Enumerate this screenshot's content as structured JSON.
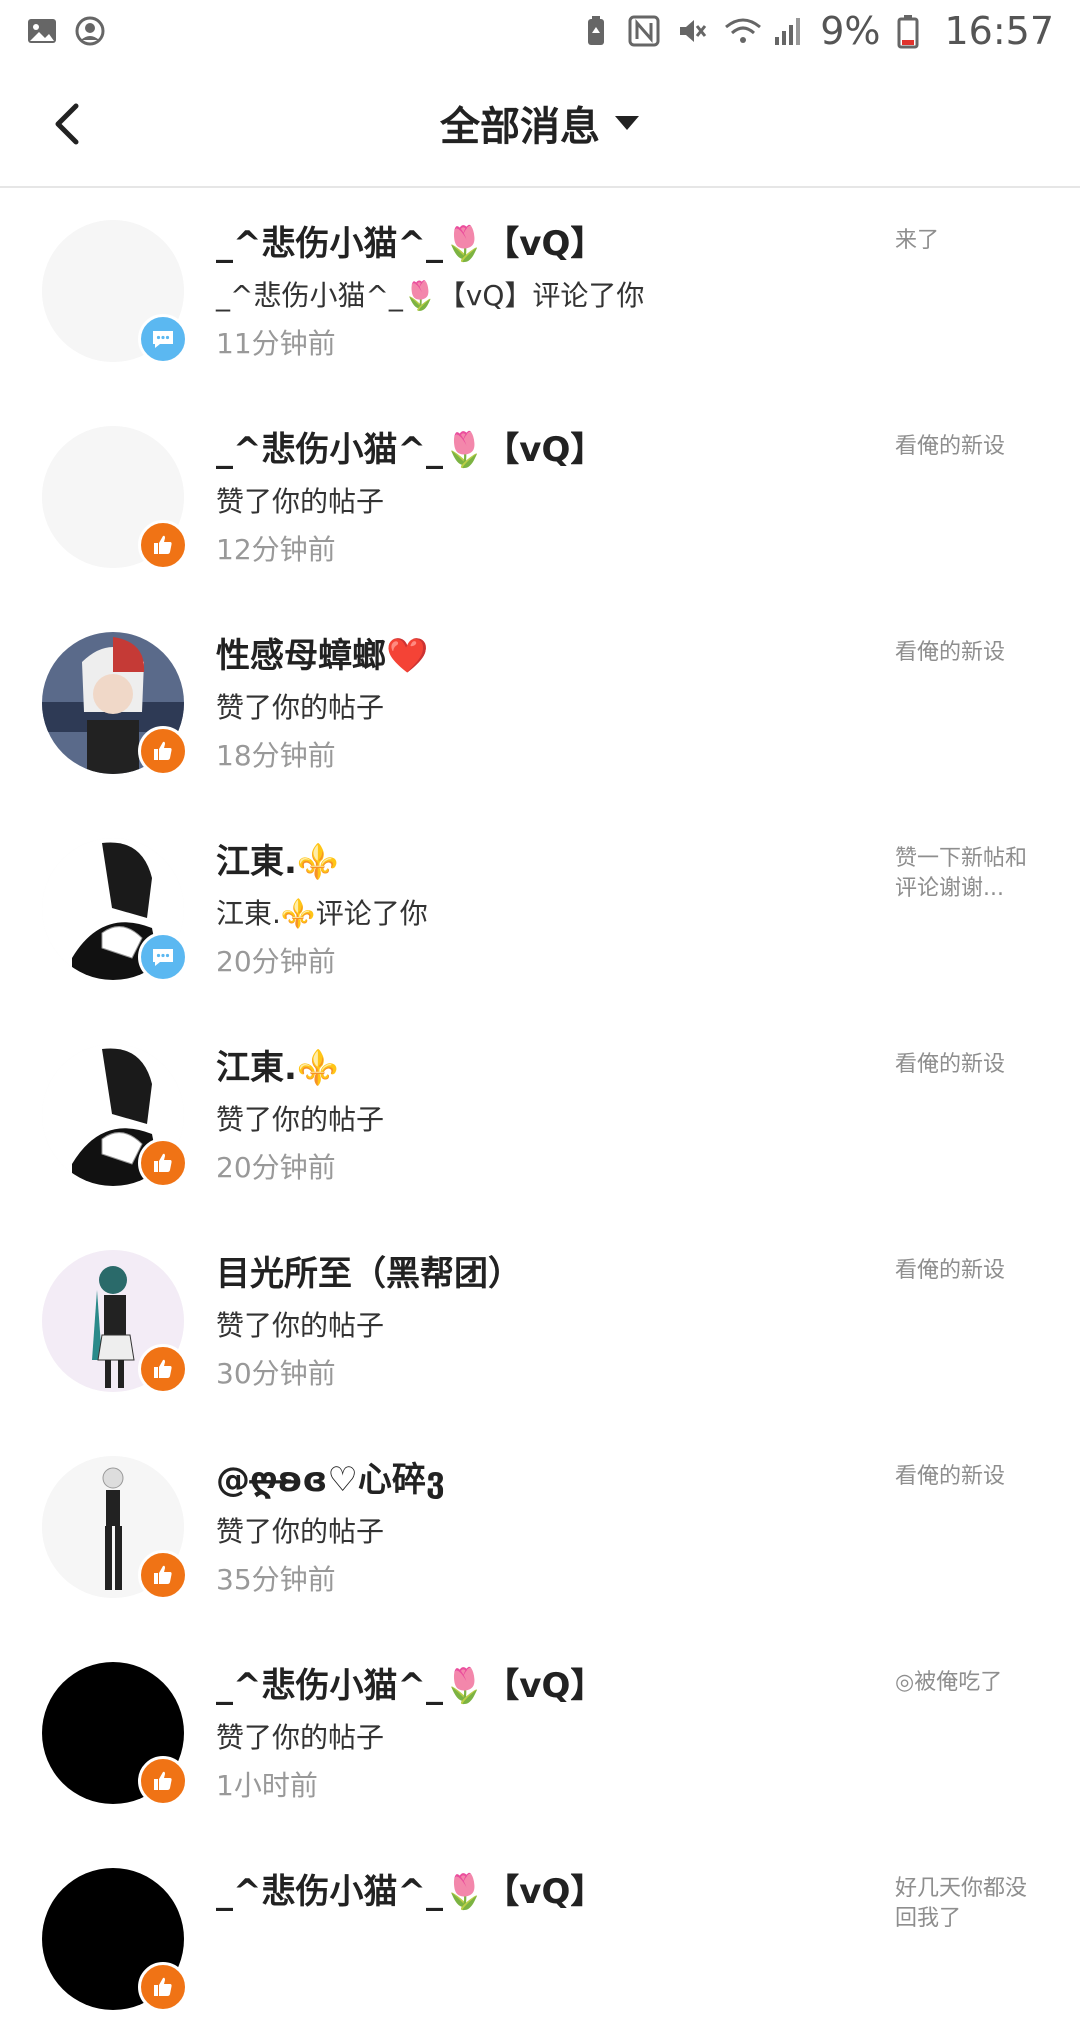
{
  "status_bar": {
    "battery": "9%",
    "time": "16:57",
    "icons": [
      "image-icon",
      "account-icon",
      "battery-saver-icon",
      "nfc-icon",
      "mute-icon",
      "wifi-icon",
      "signal-icon",
      "battery-icon"
    ]
  },
  "header": {
    "title": "全部消息",
    "back_icon": "back-arrow-icon",
    "dropdown_icon": "dropdown-triangle-icon"
  },
  "colors": {
    "like_badge": "#f07315",
    "comment_badge": "#5bb8f1",
    "text_primary": "#222222",
    "text_secondary": "#999999"
  },
  "notifications": [
    {
      "name": "_^悲伤小猫^_🌷【vQ】",
      "action": "_^悲伤小猫^_🌷【vQ】评论了你",
      "time": "11分钟前",
      "snippet": "来了",
      "type": "comment"
    },
    {
      "name": "_^悲伤小猫^_🌷【vQ】",
      "action": "赞了你的帖子",
      "time": "12分钟前",
      "snippet": "看俺的新设",
      "type": "like"
    },
    {
      "name": "性感母蟑螂❤️",
      "action": "赞了你的帖子",
      "time": "18分钟前",
      "snippet": "看俺的新设",
      "type": "like"
    },
    {
      "name": "江東.⚜️",
      "action": "江東.⚜️评论了你",
      "time": "20分钟前",
      "snippet": "赞一下新帖和评论谢谢...",
      "type": "comment"
    },
    {
      "name": "江東.⚜️",
      "action": "赞了你的帖子",
      "time": "20分钟前",
      "snippet": "看俺的新设",
      "type": "like"
    },
    {
      "name": "目光所至（黑帮团）",
      "action": "赞了你的帖子",
      "time": "30分钟前",
      "snippet": "看俺的新设",
      "type": "like"
    },
    {
      "name": "@ღ̶̶ʚ̶ɞ♡心碎ვ",
      "action": "赞了你的帖子",
      "time": "35分钟前",
      "snippet": "看俺的新设",
      "type": "like"
    },
    {
      "name": "_^悲伤小猫^_🌷【vQ】",
      "action": "赞了你的帖子",
      "time": "1小时前",
      "snippet": "◎被俺吃了",
      "type": "like"
    },
    {
      "name": "_^悲伤小猫^_🌷【vQ】",
      "action": "",
      "time": "",
      "snippet": "好几天你都没回我了",
      "type": "like"
    }
  ]
}
